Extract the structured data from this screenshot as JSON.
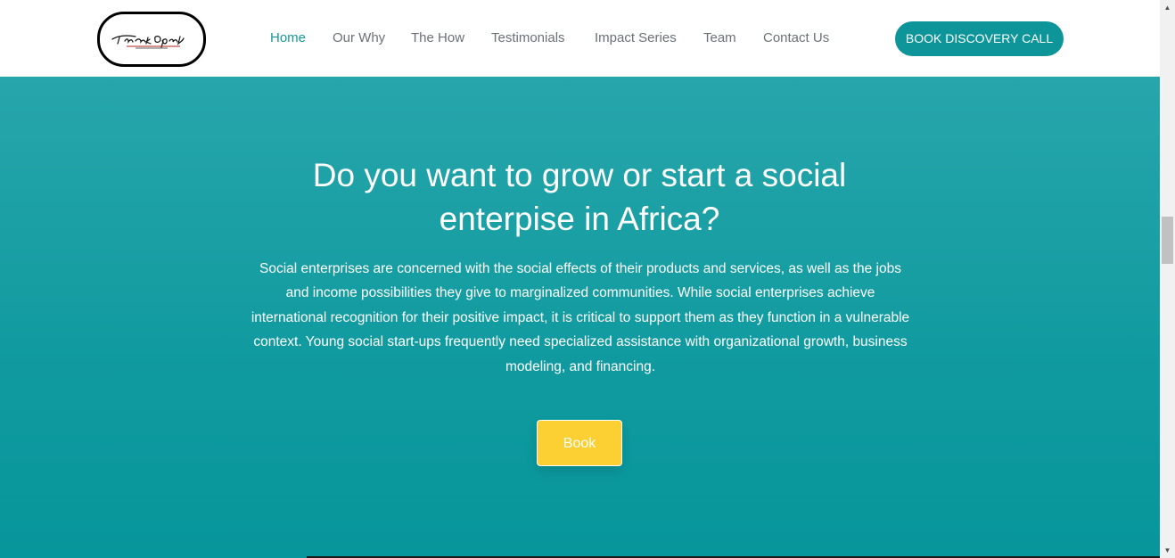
{
  "logo": {
    "text": "Think Opal",
    "icon": "logo-icon"
  },
  "nav": {
    "items": [
      {
        "label": "Home",
        "active": true
      },
      {
        "label": "Our Why",
        "active": false
      },
      {
        "label": "The How",
        "active": false
      },
      {
        "label": "Testimonials",
        "active": false
      },
      {
        "label": "Impact Series",
        "active": false
      },
      {
        "label": "Team",
        "active": false
      },
      {
        "label": "Contact Us",
        "active": false
      }
    ],
    "cta_label": "BOOK DISCOVERY CALL"
  },
  "hero": {
    "title": "Do you want to grow or start a social enterpise in Africa?",
    "text": "Social enterprises are concerned with the social effects of their products and services, as well as the jobs and income possibilities they give to marginalized communities. While social enterprises achieve international recognition for their positive impact, it is critical to support them as they function in a vulnerable context. Young social start-ups frequently need specialized assistance with organizational growth, business modeling, and financing.",
    "button_label": "Book"
  },
  "scrollbar": {
    "up_icon": "chevron-up-icon",
    "down_icon": "chevron-down-icon",
    "up_glyph": "▲",
    "down_glyph": "▼"
  },
  "colors": {
    "accent": "#0d959a",
    "nav_active": "#16979b",
    "nav_text": "#6b7178",
    "hero_top": "#27a6ab",
    "hero_bottom": "#07969b",
    "button_yellow": "#fccf33"
  }
}
